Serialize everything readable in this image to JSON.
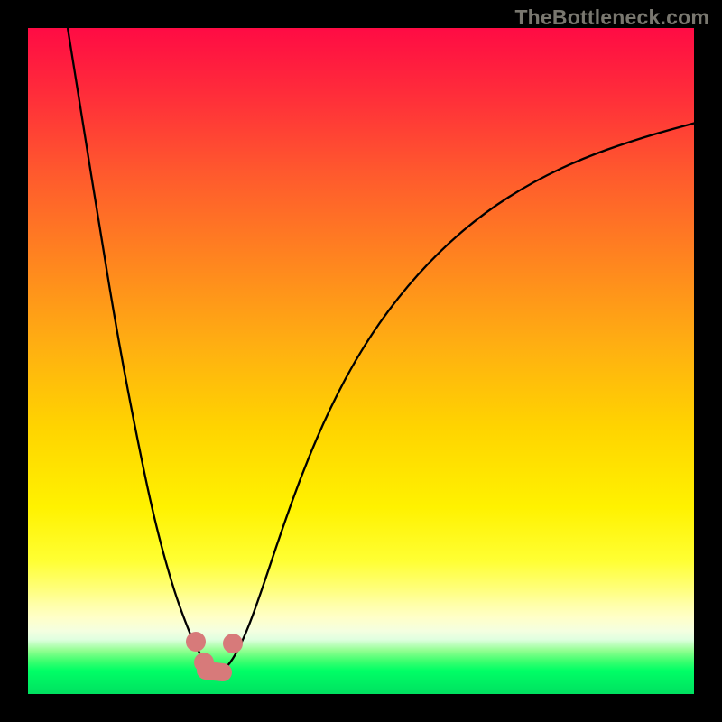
{
  "watermark": "TheBottleneck.com",
  "colors": {
    "black": "#000000",
    "curve": "#000000",
    "marker_fill": "#d77a7a",
    "marker_stroke": "#c76a6a",
    "gradient_stops": [
      {
        "offset": 0.0,
        "color": "#ff0b44"
      },
      {
        "offset": 0.1,
        "color": "#ff2d3a"
      },
      {
        "offset": 0.22,
        "color": "#ff5a2d"
      },
      {
        "offset": 0.35,
        "color": "#ff851f"
      },
      {
        "offset": 0.48,
        "color": "#ffb011"
      },
      {
        "offset": 0.6,
        "color": "#ffd400"
      },
      {
        "offset": 0.72,
        "color": "#fff200"
      },
      {
        "offset": 0.8,
        "color": "#ffff33"
      },
      {
        "offset": 0.845,
        "color": "#ffff80"
      },
      {
        "offset": 0.865,
        "color": "#ffffa8"
      },
      {
        "offset": 0.885,
        "color": "#ffffc8"
      },
      {
        "offset": 0.905,
        "color": "#f4ffe0"
      },
      {
        "offset": 0.918,
        "color": "#e0ffe0"
      },
      {
        "offset": 0.925,
        "color": "#c0ffc0"
      },
      {
        "offset": 0.935,
        "color": "#90ff90"
      },
      {
        "offset": 0.95,
        "color": "#40ff70"
      },
      {
        "offset": 0.965,
        "color": "#00ff66"
      },
      {
        "offset": 1.0,
        "color": "#00e060"
      }
    ]
  },
  "chart_data": {
    "type": "line",
    "title": "",
    "xlabel": "",
    "ylabel": "",
    "xlim": [
      0,
      738
    ],
    "ylim_note": "y axis expressed in plot-area pixel coordinates (0 = top)",
    "series": [
      {
        "name": "bottleneck-curve",
        "x": [
          44,
          60,
          80,
          100,
          120,
          140,
          160,
          175,
          186,
          195,
          203,
          210,
          218,
          230,
          244,
          260,
          280,
          305,
          335,
          370,
          410,
          455,
          505,
          560,
          620,
          685,
          740
        ],
        "y": [
          0,
          100,
          225,
          345,
          450,
          545,
          618,
          660,
          686,
          700,
          710,
          715,
          711,
          695,
          665,
          620,
          560,
          490,
          420,
          355,
          298,
          248,
          205,
          170,
          142,
          120,
          105
        ]
      }
    ],
    "markers": [
      {
        "name": "left-upper-dot",
        "x": 186,
        "y": 680,
        "r": 11
      },
      {
        "name": "left-lower-dot",
        "x": 195,
        "y": 703,
        "r": 11
      },
      {
        "name": "bottom-connector",
        "type": "capsule",
        "x1": 197,
        "y1": 712,
        "x2": 216,
        "y2": 714,
        "width": 20
      },
      {
        "name": "right-dot",
        "x": 227,
        "y": 682,
        "r": 11
      }
    ]
  }
}
